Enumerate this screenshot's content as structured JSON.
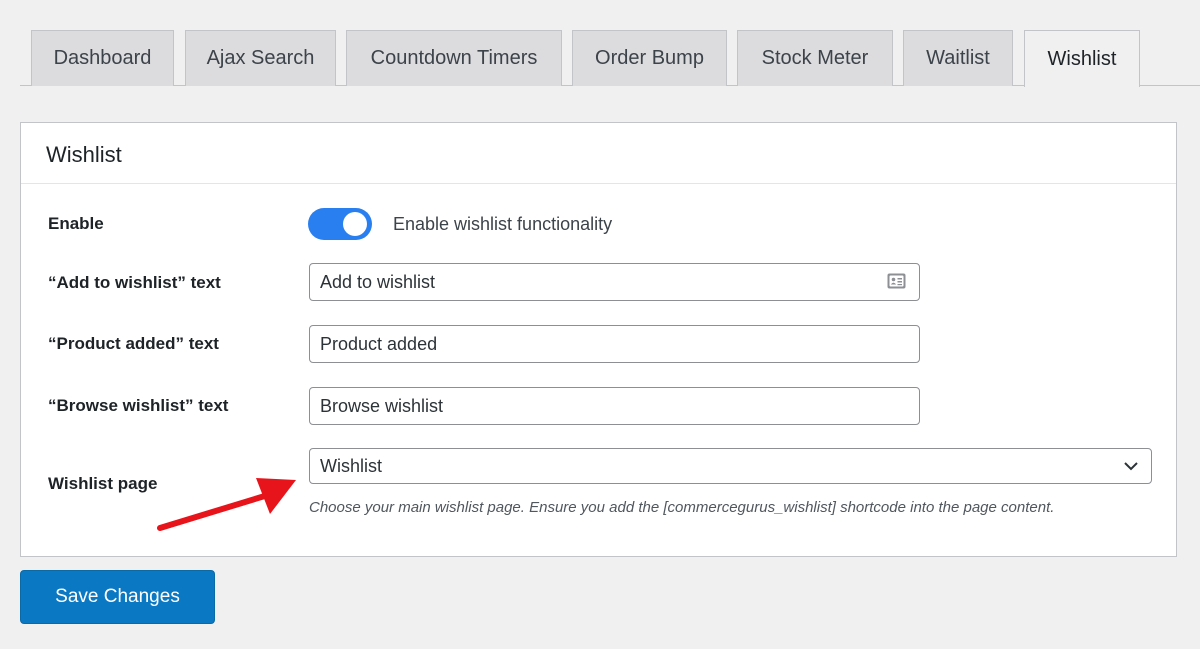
{
  "tabs": [
    {
      "label": "Dashboard",
      "active": false
    },
    {
      "label": "Ajax Search",
      "active": false
    },
    {
      "label": "Countdown Timers",
      "active": false
    },
    {
      "label": "Order Bump",
      "active": false
    },
    {
      "label": "Stock Meter",
      "active": false
    },
    {
      "label": "Waitlist",
      "active": false
    },
    {
      "label": "Wishlist",
      "active": true
    }
  ],
  "panel": {
    "title": "Wishlist",
    "enable": {
      "label": "Enable",
      "toggle_on": true,
      "toggle_text": "Enable wishlist functionality"
    },
    "add_to_wishlist": {
      "label": "“Add to wishlist” text",
      "value": "Add to wishlist",
      "icon": "contact-card-icon"
    },
    "product_added": {
      "label": "“Product added” text",
      "value": "Product added"
    },
    "browse_wishlist": {
      "label": "“Browse wishlist” text",
      "value": "Browse wishlist"
    },
    "wishlist_page": {
      "label": "Wishlist page",
      "selected": "Wishlist",
      "help": "Choose your main wishlist page. Ensure you add the [commercegurus_wishlist] shortcode into the page content."
    }
  },
  "save_button": "Save Changes",
  "colors": {
    "accent": "#2a7ff0",
    "button": "#0b78c3",
    "arrow": "#e8141b"
  }
}
